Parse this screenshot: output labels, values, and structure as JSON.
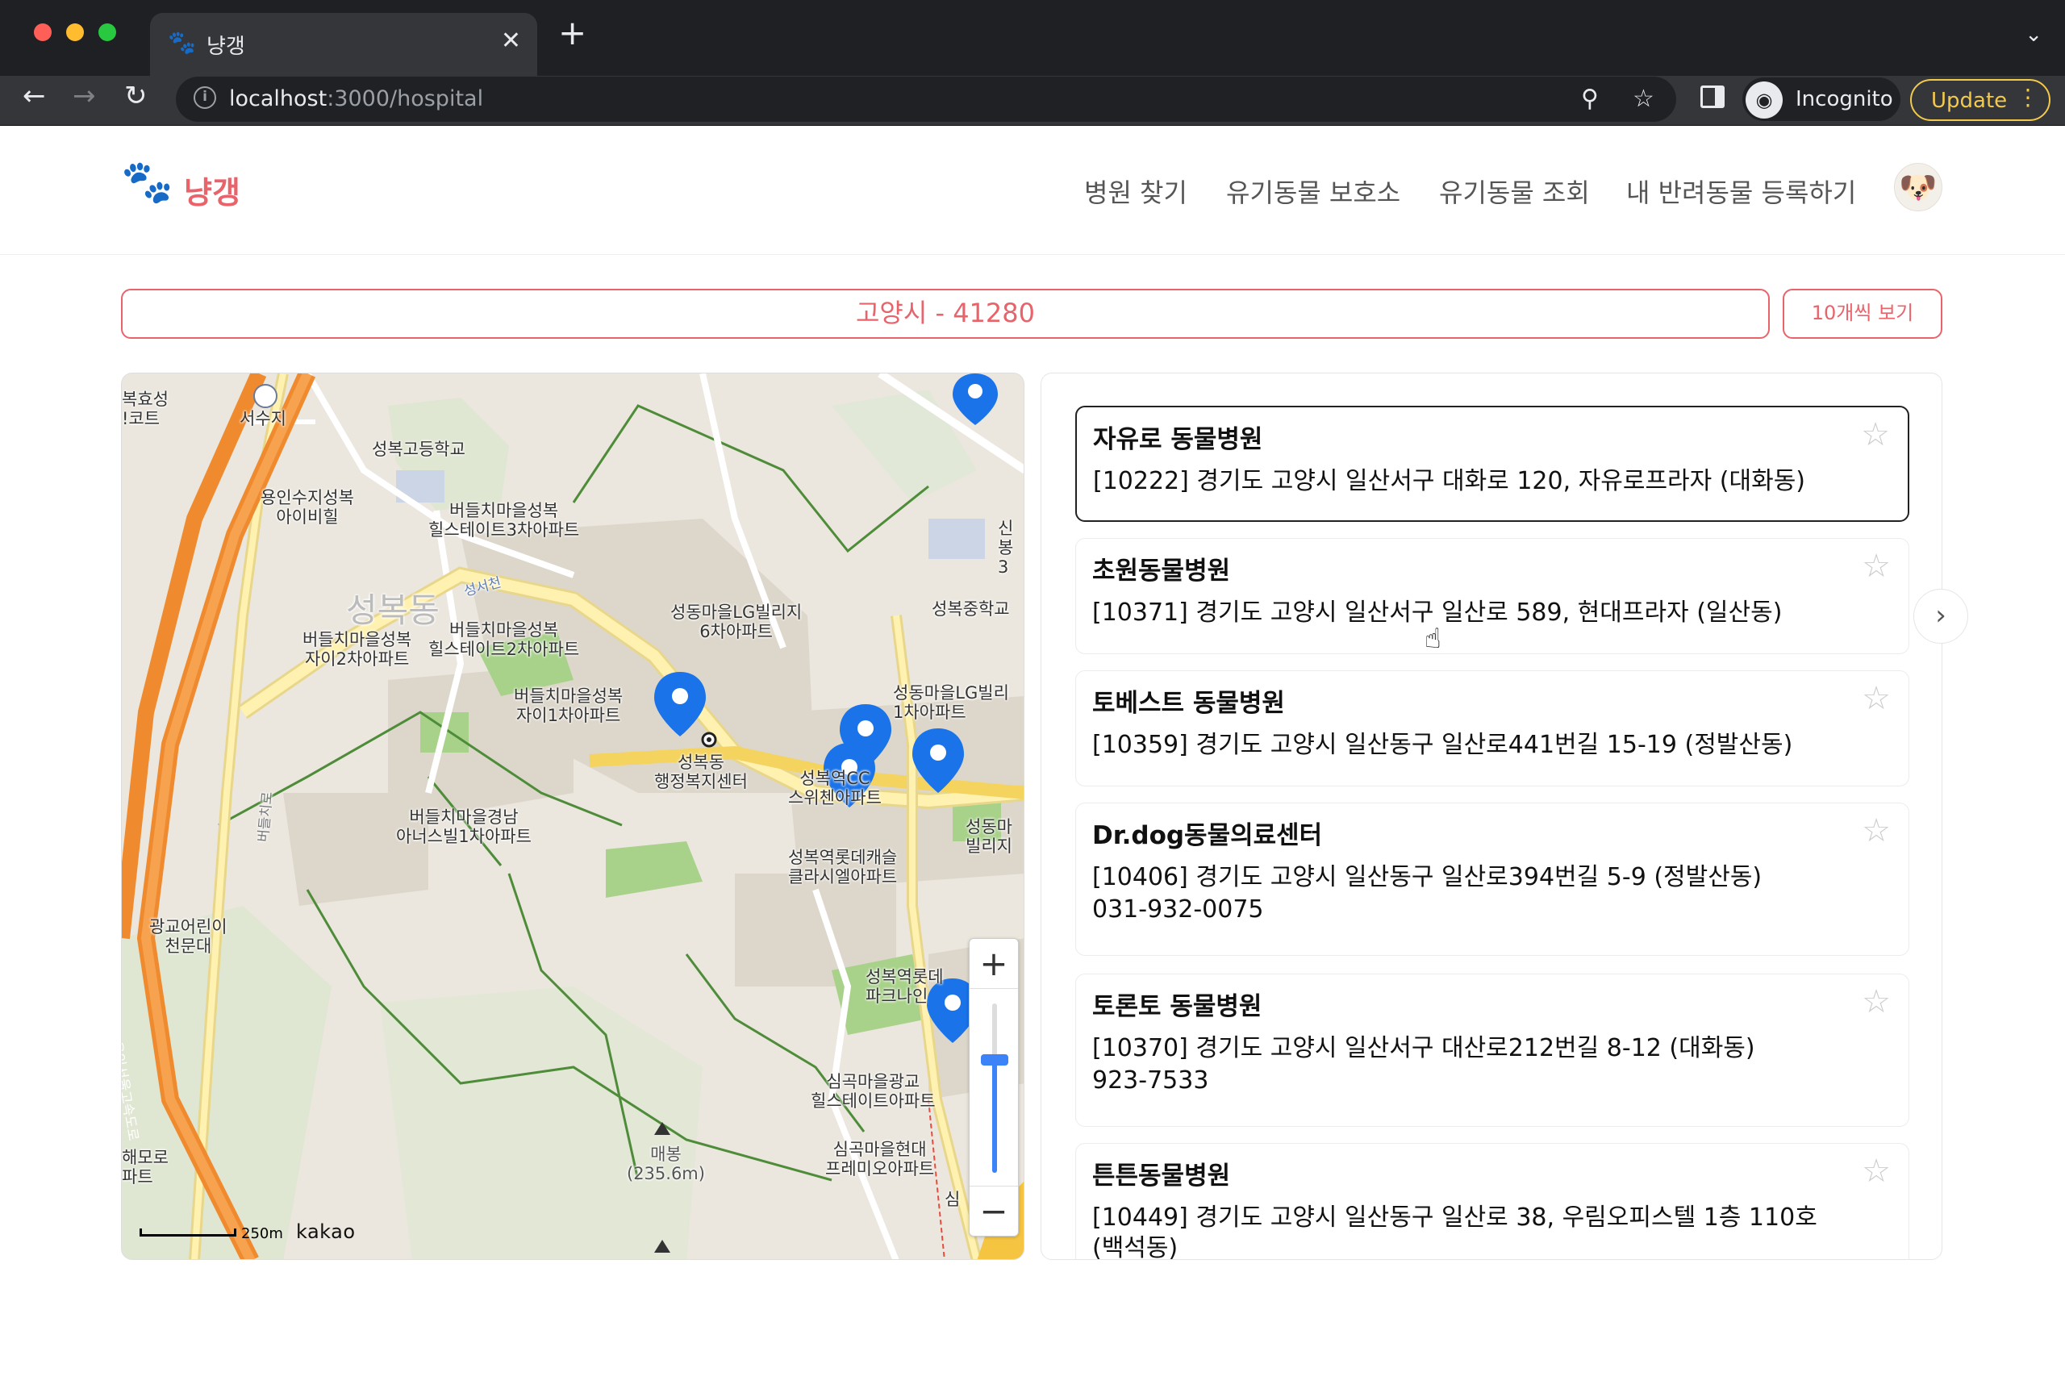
{
  "browser": {
    "tab_title": "냥갱",
    "tab_favicon": "🐾",
    "url_host": "localhost",
    "url_path": ":3000/hospital",
    "incognito_label": "Incognito",
    "update_label": "Update"
  },
  "header": {
    "logo_icon": "🐾",
    "logo_text": "냥갱",
    "nav": [
      "병원 찾기",
      "유기동물 보호소",
      "유기동물 조회",
      "내 반려동물 등록하기"
    ],
    "avatar": "🐶"
  },
  "region": {
    "label": "고양시 - 41280",
    "view_button": "10개씩 보기"
  },
  "map": {
    "labels": {
      "l1": "복효성\n!코트",
      "l2": "서수지",
      "l3": "성복고등학교",
      "l4": "용인수지성복\n아이비힐",
      "l5": "버들치마을성복\n힐스테이트3차아파트",
      "l6": "신봉\n3",
      "l7": "성복중학교",
      "l8": "성서천",
      "l9": "성복동",
      "l10": "성동마을LG빌리지\n6차아파트",
      "l11": "버들치마을성복\n힐스테이트2차아파트",
      "l12": "버들치마을성복\n자이2차아파트",
      "l13": "성동마을LG빌리\n1차아파트",
      "l14": "버들치마을성복\n자이1차아파트",
      "l15": "성복동\n행정복지센터",
      "l16": "성복역CC\n스위첸아파트",
      "l17": "버들치마을경남\n아너스빌1차아파트",
      "l18": "성동마\n빌리지",
      "l19": "성복역롯데캐슬\n클라시엘아파트",
      "l20": "광교어린이\n천문대",
      "l21": "성복역롯데\n파크나인",
      "l22": "심곡마을광교\n힐스테이트아파트",
      "l23": "매봉\n(235.6m)",
      "l24": "심곡마을현대\n프레미오아파트",
      "l25": "해모로\n파트",
      "l26": "용인서울고속도로",
      "l27": "버들치로",
      "l28": "심"
    },
    "scale": "250m",
    "attribution": "kakao",
    "zoom_in": "+",
    "zoom_out": "−"
  },
  "hospitals": [
    {
      "name": "자유로 동물병원",
      "address": "[10222] 경기도 고양시 일산서구 대화로 120, 자유로프라자 (대화동)",
      "phone": ""
    },
    {
      "name": "초원동물병원",
      "address": "[10371] 경기도 고양시 일산서구 일산로 589, 현대프라자 (일산동)",
      "phone": ""
    },
    {
      "name": "토베스트 동물병원",
      "address": "[10359] 경기도 고양시 일산동구 일산로441번길 15-19 (정발산동)",
      "phone": ""
    },
    {
      "name": "Dr.dog동물의료센터",
      "address": "[10406] 경기도 고양시 일산동구 일산로394번길 5-9 (정발산동)",
      "phone": "031-932-0075"
    },
    {
      "name": "토론토 동물병원",
      "address": "[10370] 경기도 고양시 일산서구 대산로212번길 8-12 (대화동)",
      "phone": "923-7533"
    },
    {
      "name": "튼튼동물병원",
      "address": "[10449] 경기도 고양시 일산동구 일산로 38, 우림오피스텔 1층 110호",
      "phone": "(백석동)"
    }
  ],
  "next_icon": "›",
  "star_icon": "☆",
  "colors": {
    "accent": "#e8636a",
    "marker": "#1a73e8"
  }
}
